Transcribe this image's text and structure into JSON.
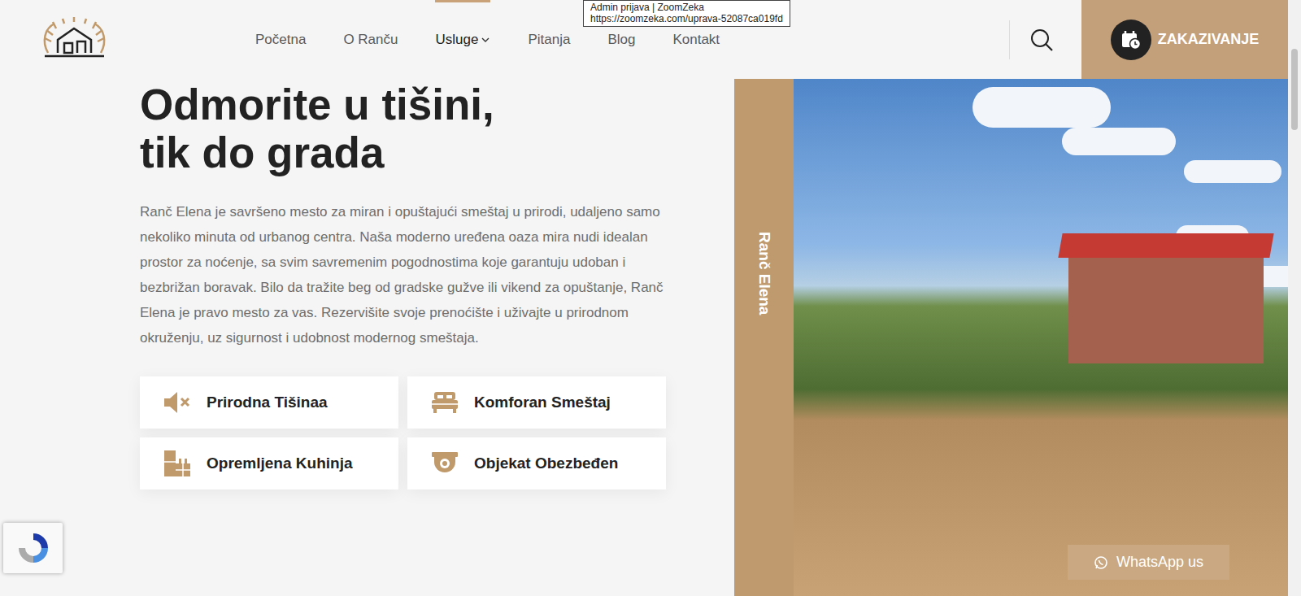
{
  "tooltip": {
    "lines": [
      "Admin prijava | ZoomZeka",
      "https://zoomzeka.com/uprava-52087ca019fd"
    ]
  },
  "header": {
    "nav": [
      {
        "label": "Početna",
        "selected": false,
        "dropdown": false
      },
      {
        "label": "O Ranču",
        "selected": false,
        "dropdown": false
      },
      {
        "label": "Usluge",
        "selected": true,
        "dropdown": true
      },
      {
        "label": "Pitanja",
        "selected": false,
        "dropdown": false
      },
      {
        "label": "Blog",
        "selected": false,
        "dropdown": false
      },
      {
        "label": "Kontakt",
        "selected": false,
        "dropdown": false
      }
    ],
    "cta": {
      "label": "ZAKAZIVANJE"
    }
  },
  "hero": {
    "title_lines": [
      "Odmorite u tišini,",
      "tik do grada"
    ],
    "paragraph": "Ranč Elena je savršeno mesto za miran i opuštajući smeštaj u prirodi, udaljeno samo nekoliko minuta od urbanog centra. Naša moderno uređena oaza mira nudi idealan prostor za noćenje, sa svim savremenim pogodnostima koje garantuju udoban i bezbrižan boravak. Bilo da tražite beg od gradske gužve ili vikend za opuštanje, Ranč Elena je pravo mesto za vas. Rezervišite svoje prenoćište i uživajte u prirodnom okruženju, uz sigurnost i udobnost modernog smeštaja.",
    "features": [
      {
        "label": "Prirodna Tišinaa"
      },
      {
        "label": "Komforan Smeštaj"
      },
      {
        "label": "Opremljena Kuhinja"
      },
      {
        "label": "Objekat Obezbeđen"
      }
    ]
  },
  "gallery": {
    "caption": "Ranč Elena"
  },
  "whatsapp": {
    "label": "WhatsApp us"
  }
}
